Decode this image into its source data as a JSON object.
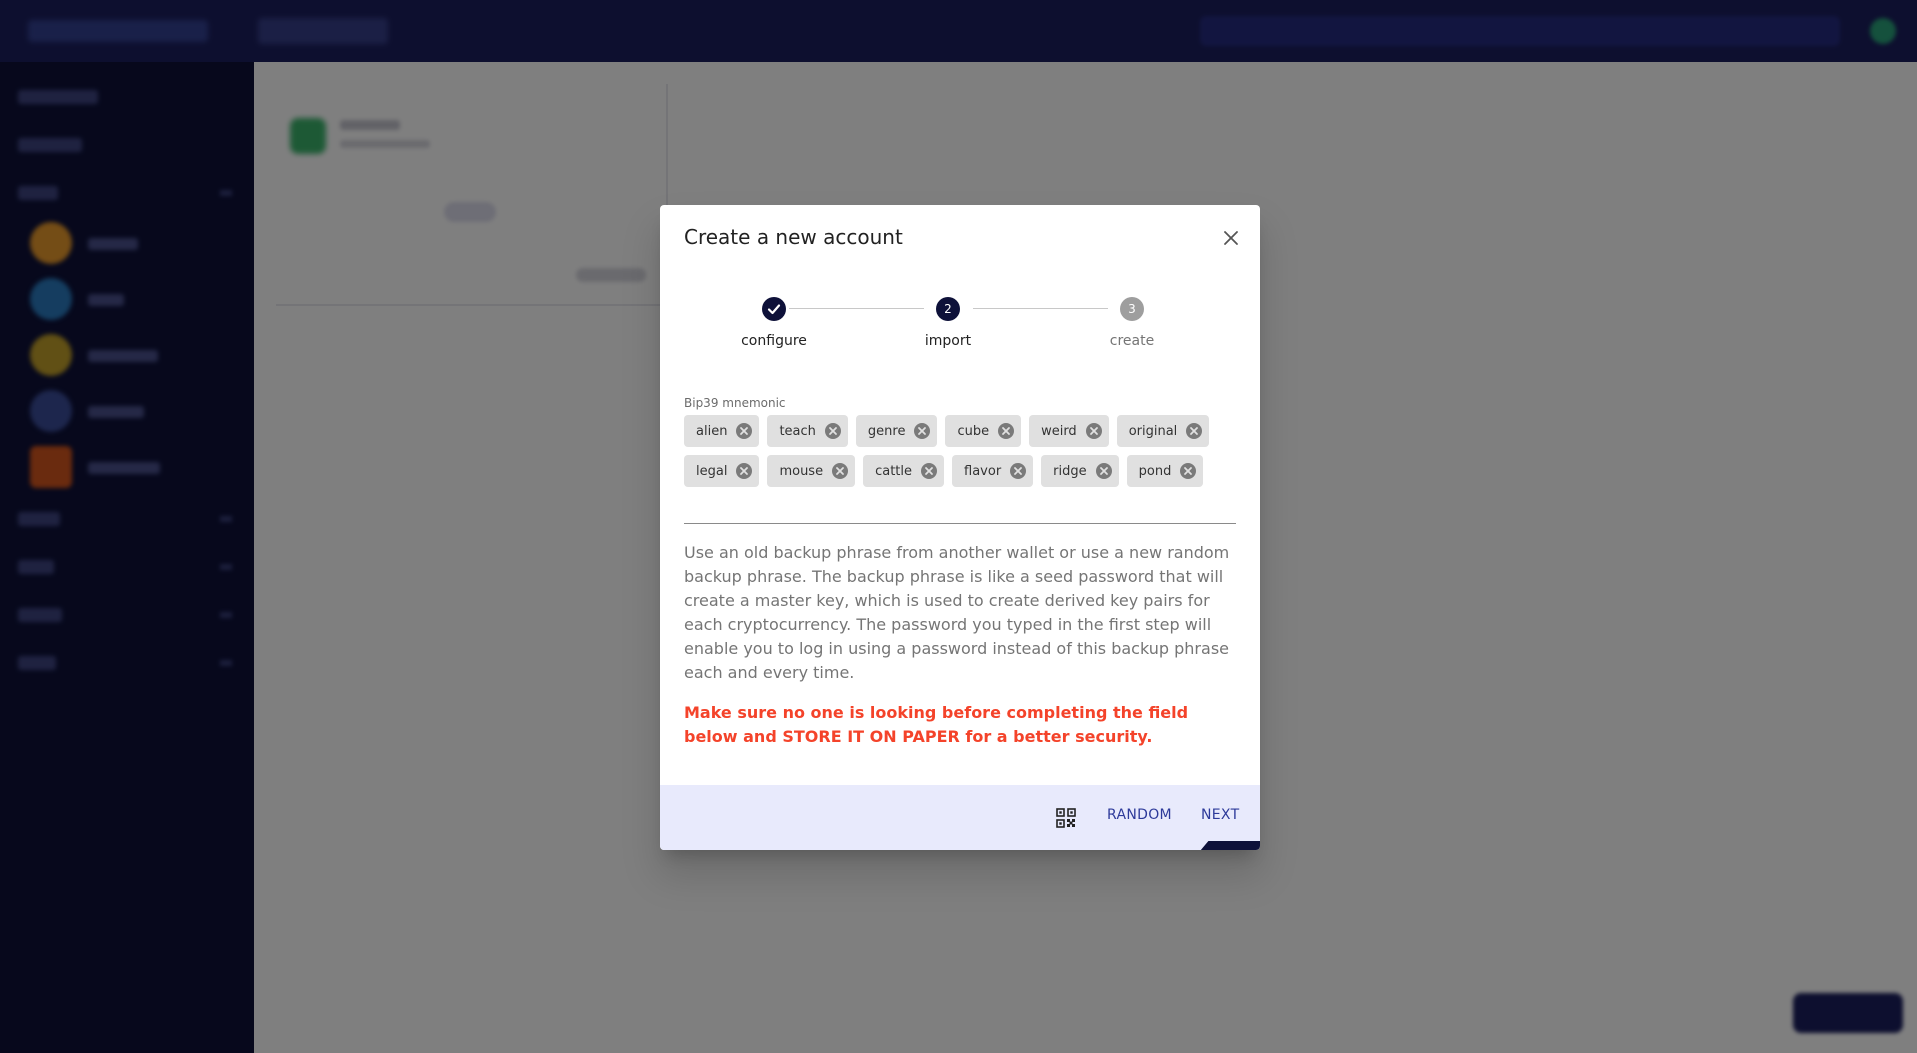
{
  "dialog": {
    "title": "Create a new account"
  },
  "stepper": {
    "steps": [
      {
        "label": "configure",
        "number": "1",
        "state": "done"
      },
      {
        "label": "import",
        "number": "2",
        "state": "active"
      },
      {
        "label": "create",
        "number": "3",
        "state": "pending"
      }
    ]
  },
  "mnemonic": {
    "label": "Bip39 mnemonic",
    "words": [
      "alien",
      "teach",
      "genre",
      "cube",
      "weird",
      "original",
      "legal",
      "mouse",
      "cattle",
      "flavor",
      "ridge",
      "pond"
    ]
  },
  "help_text": "Use an old backup phrase from another wallet or use a new random backup phrase. The backup phrase is like a seed password that will create a master key, which is used to create derived key pairs for each cryptocurrency. The password you typed in the first step will enable you to log in using a password instead of this backup phrase each and every time.",
  "warning_text": "Make sure no one is looking before completing the field below and STORE IT ON PAPER for a better security.",
  "footer": {
    "qr_icon": "qr-code-icon",
    "random_label": "RANDOM",
    "next_label": "NEXT"
  },
  "colors": {
    "primary": "#0e1139",
    "accent": "#2d3a9a",
    "warning": "#f4432a",
    "footer_bg": "#e8eafc",
    "sidebar_bg": "#0e1139"
  }
}
